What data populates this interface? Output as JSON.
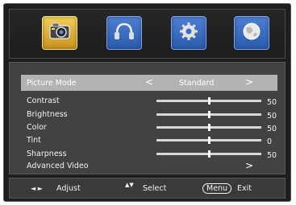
{
  "tabs": [
    {
      "name": "picture",
      "icon": "camera-icon",
      "active": true
    },
    {
      "name": "sound",
      "icon": "headphones-icon",
      "active": false
    },
    {
      "name": "setup",
      "icon": "gear-icon",
      "active": false
    },
    {
      "name": "channel",
      "icon": "globe-icon",
      "active": false
    }
  ],
  "menu": {
    "picture_mode": {
      "label": "Picture Mode",
      "value": "Standard",
      "left_arrow": "<",
      "right_arrow": ">"
    },
    "sliders": [
      {
        "label": "Contrast",
        "value": "50",
        "level": 0.5
      },
      {
        "label": "Brightness",
        "value": "50",
        "level": 0.5
      },
      {
        "label": "Color",
        "value": "50",
        "level": 0.5
      },
      {
        "label": "Tint",
        "value": "0",
        "level": 0.5
      },
      {
        "label": "Sharpness",
        "value": "50",
        "level": 0.5
      }
    ],
    "advanced": {
      "label": "Advanced Video",
      "arrow": ">"
    }
  },
  "footer": {
    "adjust_arrows": "◄ ►",
    "adjust_label": "Adjust",
    "select_arrows": "▲▼",
    "select_label": "Select",
    "menu_key": "Menu",
    "exit_label": "Exit"
  },
  "colors": {
    "active_tab": "#e5b23d",
    "inactive_tab": "#3a6cc0",
    "selected_row": "#b3b3b3",
    "panel": "#424242"
  }
}
